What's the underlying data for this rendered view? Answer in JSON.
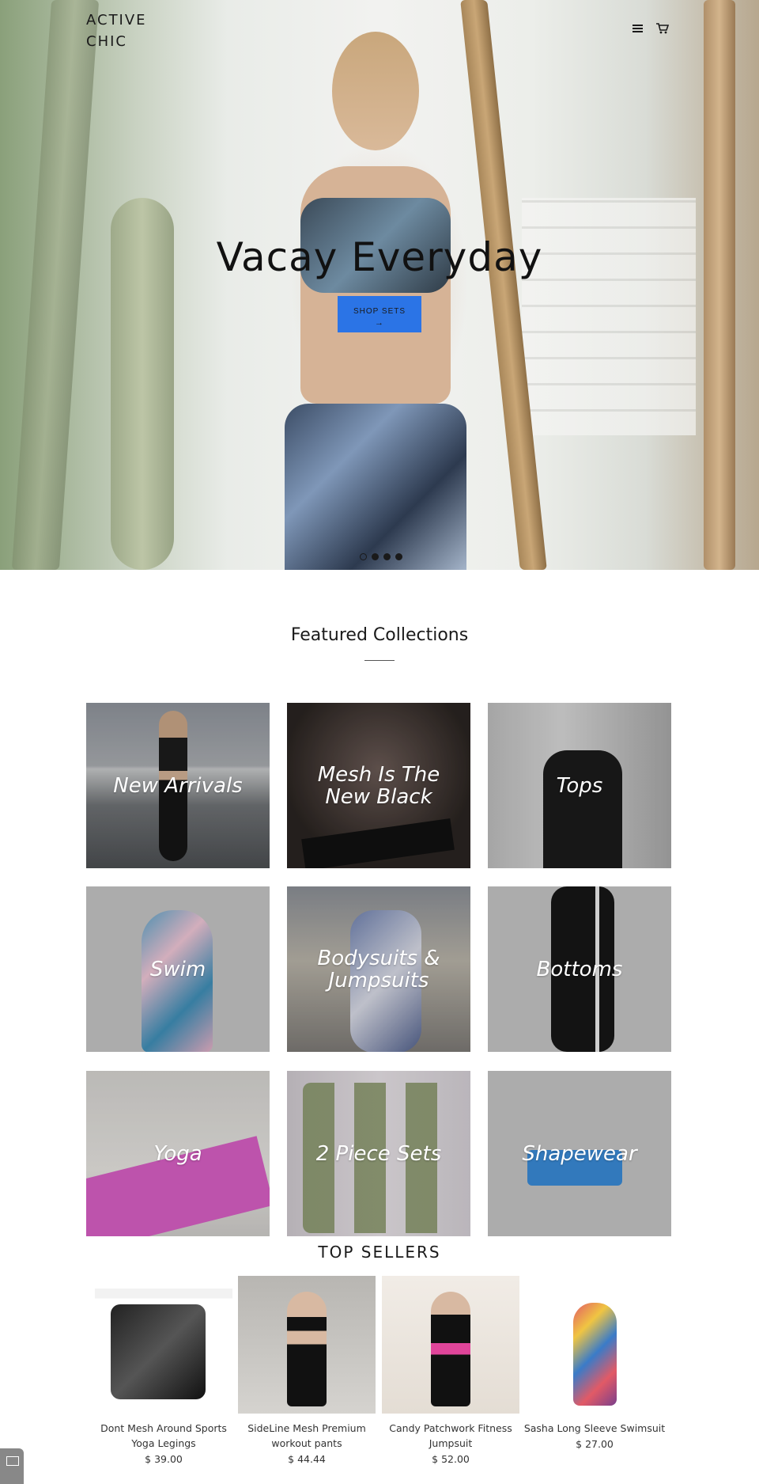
{
  "header": {
    "logo": "ACTIVE CHIC",
    "menu_icon": "hamburger-menu-icon",
    "cart_icon": "shopping-cart-icon"
  },
  "hero": {
    "title": "Vacay Everyday",
    "button_label": "SHOP SETS",
    "button_arrow": "→",
    "button_color": "#2b74e6",
    "slide_count": 4,
    "active_slide": 1
  },
  "featured": {
    "title": "Featured Collections",
    "collections": [
      {
        "label": "New Arrivals"
      },
      {
        "label": "Mesh Is The New Black"
      },
      {
        "label": "Tops"
      },
      {
        "label": "Swim"
      },
      {
        "label": "Bodysuits & Jumpsuits"
      },
      {
        "label": "Bottoms"
      },
      {
        "label": "Yoga"
      },
      {
        "label": "2 Piece Sets"
      },
      {
        "label": "Shapewear"
      }
    ]
  },
  "top_sellers": {
    "title": "TOP SELLERS",
    "products": [
      {
        "name": "Dont Mesh Around Sports Yoga Legings",
        "price": "$ 39.00"
      },
      {
        "name": "SideLine Mesh Premium workout pants",
        "price": "$ 44.44"
      },
      {
        "name": "Candy Patchwork Fitness Jumpsuit",
        "price": "$ 52.00"
      },
      {
        "name": "Sasha Long Sleeve Swimsuit",
        "price": "$ 27.00"
      }
    ]
  },
  "chat": {
    "icon": "chat-envelope-icon"
  }
}
